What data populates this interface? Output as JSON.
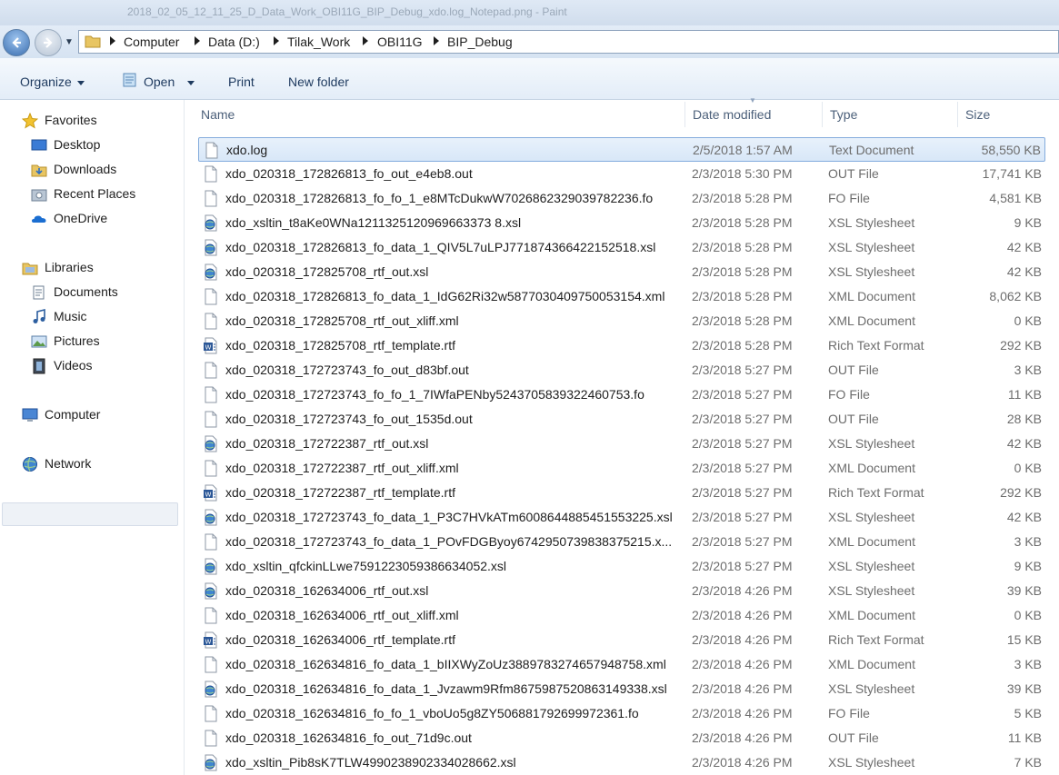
{
  "window": {
    "title": "2018_02_05_12_11_25_D_Data_Work_OBI11G_BIP_Debug_xdo.log_Notepad.png - Paint"
  },
  "address": {
    "breadcrumbs": [
      "Computer",
      "Data (D:)",
      "Tilak_Work",
      "OBI11G",
      "BIP_Debug"
    ]
  },
  "toolbar": {
    "organize": "Organize",
    "open": "Open",
    "print": "Print",
    "new_folder": "New folder"
  },
  "nav": {
    "favorites": "Favorites",
    "desktop": "Desktop",
    "downloads": "Downloads",
    "recent_places": "Recent Places",
    "onedrive": "OneDrive",
    "libraries": "Libraries",
    "documents": "Documents",
    "music": "Music",
    "pictures": "Pictures",
    "videos": "Videos",
    "computer": "Computer",
    "network": "Network"
  },
  "columns": {
    "name": "Name",
    "date_modified": "Date modified",
    "type": "Type",
    "size": "Size"
  },
  "icons": {
    "text": "text-file-icon",
    "xsl": "xsl-stylesheet-icon",
    "rtf": "word-rtf-icon"
  },
  "files": [
    {
      "name": "xdo.log",
      "date": "2/5/2018 1:57 AM",
      "type": "Text Document",
      "size": "58,550 KB",
      "icon": "text",
      "selected": true
    },
    {
      "name": "xdo_020318_172826813_fo_out_e4eb8.out",
      "date": "2/3/2018 5:30 PM",
      "type": "OUT File",
      "size": "17,741 KB",
      "icon": "text"
    },
    {
      "name": "xdo_020318_172826813_fo_fo_1_e8MTcDukwW7026862329039782236.fo",
      "date": "2/3/2018 5:28 PM",
      "type": "FO File",
      "size": "4,581 KB",
      "icon": "text"
    },
    {
      "name": "xdo_xsltin_t8aKe0WNa1211325120969663373 8.xsl",
      "date": "2/3/2018 5:28 PM",
      "type": "XSL Stylesheet",
      "size": "9 KB",
      "icon": "xsl"
    },
    {
      "name": "xdo_020318_172826813_fo_data_1_QIV5L7uLPJ771874366422152518.xsl",
      "date": "2/3/2018 5:28 PM",
      "type": "XSL Stylesheet",
      "size": "42 KB",
      "icon": "xsl"
    },
    {
      "name": "xdo_020318_172825708_rtf_out.xsl",
      "date": "2/3/2018 5:28 PM",
      "type": "XSL Stylesheet",
      "size": "42 KB",
      "icon": "xsl"
    },
    {
      "name": "xdo_020318_172826813_fo_data_1_IdG62Ri32w5877030409750053154.xml",
      "date": "2/3/2018 5:28 PM",
      "type": "XML Document",
      "size": "8,062 KB",
      "icon": "text"
    },
    {
      "name": "xdo_020318_172825708_rtf_out_xliff.xml",
      "date": "2/3/2018 5:28 PM",
      "type": "XML Document",
      "size": "0 KB",
      "icon": "text"
    },
    {
      "name": "xdo_020318_172825708_rtf_template.rtf",
      "date": "2/3/2018 5:28 PM",
      "type": "Rich Text Format",
      "size": "292 KB",
      "icon": "rtf"
    },
    {
      "name": "xdo_020318_172723743_fo_out_d83bf.out",
      "date": "2/3/2018 5:27 PM",
      "type": "OUT File",
      "size": "3 KB",
      "icon": "text"
    },
    {
      "name": "xdo_020318_172723743_fo_fo_1_7IWfaPENby5243705839322460753.fo",
      "date": "2/3/2018 5:27 PM",
      "type": "FO File",
      "size": "11 KB",
      "icon": "text"
    },
    {
      "name": "xdo_020318_172723743_fo_out_1535d.out",
      "date": "2/3/2018 5:27 PM",
      "type": "OUT File",
      "size": "28 KB",
      "icon": "text"
    },
    {
      "name": "xdo_020318_172722387_rtf_out.xsl",
      "date": "2/3/2018 5:27 PM",
      "type": "XSL Stylesheet",
      "size": "42 KB",
      "icon": "xsl"
    },
    {
      "name": "xdo_020318_172722387_rtf_out_xliff.xml",
      "date": "2/3/2018 5:27 PM",
      "type": "XML Document",
      "size": "0 KB",
      "icon": "text"
    },
    {
      "name": "xdo_020318_172722387_rtf_template.rtf",
      "date": "2/3/2018 5:27 PM",
      "type": "Rich Text Format",
      "size": "292 KB",
      "icon": "rtf"
    },
    {
      "name": "xdo_020318_172723743_fo_data_1_P3C7HVkATm6008644885451553225.xsl",
      "date": "2/3/2018 5:27 PM",
      "type": "XSL Stylesheet",
      "size": "42 KB",
      "icon": "xsl"
    },
    {
      "name": "xdo_020318_172723743_fo_data_1_POvFDGByoy6742950739838375215.x...",
      "date": "2/3/2018 5:27 PM",
      "type": "XML Document",
      "size": "3 KB",
      "icon": "text"
    },
    {
      "name": "xdo_xsltin_qfckinLLwe7591223059386634052.xsl",
      "date": "2/3/2018 5:27 PM",
      "type": "XSL Stylesheet",
      "size": "9 KB",
      "icon": "xsl"
    },
    {
      "name": "xdo_020318_162634006_rtf_out.xsl",
      "date": "2/3/2018 4:26 PM",
      "type": "XSL Stylesheet",
      "size": "39 KB",
      "icon": "xsl"
    },
    {
      "name": "xdo_020318_162634006_rtf_out_xliff.xml",
      "date": "2/3/2018 4:26 PM",
      "type": "XML Document",
      "size": "0 KB",
      "icon": "text"
    },
    {
      "name": "xdo_020318_162634006_rtf_template.rtf",
      "date": "2/3/2018 4:26 PM",
      "type": "Rich Text Format",
      "size": "15 KB",
      "icon": "rtf"
    },
    {
      "name": "xdo_020318_162634816_fo_data_1_bIIXWyZoUz3889783274657948758.xml",
      "date": "2/3/2018 4:26 PM",
      "type": "XML Document",
      "size": "3 KB",
      "icon": "text"
    },
    {
      "name": "xdo_020318_162634816_fo_data_1_Jvzawm9Rfm8675987520863149338.xsl",
      "date": "2/3/2018 4:26 PM",
      "type": "XSL Stylesheet",
      "size": "39 KB",
      "icon": "xsl"
    },
    {
      "name": "xdo_020318_162634816_fo_fo_1_vboUo5g8ZY506881792699972361.fo",
      "date": "2/3/2018 4:26 PM",
      "type": "FO File",
      "size": "5 KB",
      "icon": "text"
    },
    {
      "name": "xdo_020318_162634816_fo_out_71d9c.out",
      "date": "2/3/2018 4:26 PM",
      "type": "OUT File",
      "size": "11 KB",
      "icon": "text"
    },
    {
      "name": "xdo_xsltin_Pib8sK7TLW4990238902334028662.xsl",
      "date": "2/3/2018 4:26 PM",
      "type": "XSL Stylesheet",
      "size": "7 KB",
      "icon": "xsl"
    }
  ]
}
